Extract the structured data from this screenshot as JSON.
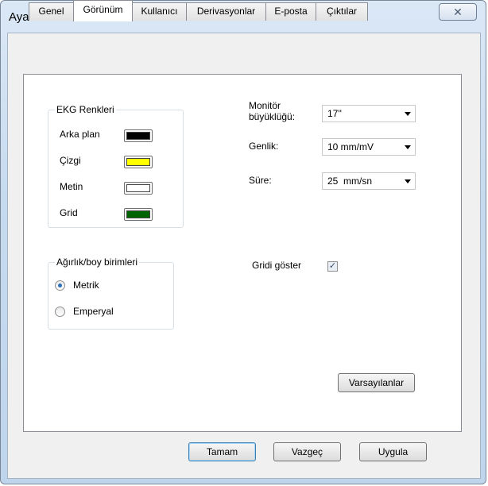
{
  "window": {
    "title": "Ayarlar",
    "close_glyph": "✕"
  },
  "tabs": [
    {
      "label": "Genel"
    },
    {
      "label": "Görünüm"
    },
    {
      "label": "Kullanıcı"
    },
    {
      "label": "Derivasyonlar"
    },
    {
      "label": "E-posta"
    },
    {
      "label": "Çıktılar"
    }
  ],
  "active_tab": "Görünüm",
  "ekg_colors": {
    "title": "EKG Renkleri",
    "items": [
      {
        "label": "Arka plan",
        "color": "#000000"
      },
      {
        "label": "Çizgi",
        "color": "#ffff00"
      },
      {
        "label": "Metin",
        "color": "#ffffff"
      },
      {
        "label": "Grid",
        "color": "#006400"
      }
    ]
  },
  "monitor": {
    "label": "Monitör\nbüyüklüğü:",
    "value": "17''"
  },
  "amplitude": {
    "label": "Genlik:",
    "value": "10 mm/mV"
  },
  "duration": {
    "label": "Süre:",
    "value": "25  mm/sn"
  },
  "units": {
    "title": "Ağırlık/boy birimleri",
    "options": [
      {
        "label": "Metrik",
        "checked": true
      },
      {
        "label": "Emperyal",
        "checked": false
      }
    ]
  },
  "show_grid": {
    "label": "Gridi göster",
    "checked": true
  },
  "buttons": {
    "defaults": "Varsayılanlar",
    "ok": "Tamam",
    "cancel": "Vazgeç",
    "apply": "Uygula"
  }
}
